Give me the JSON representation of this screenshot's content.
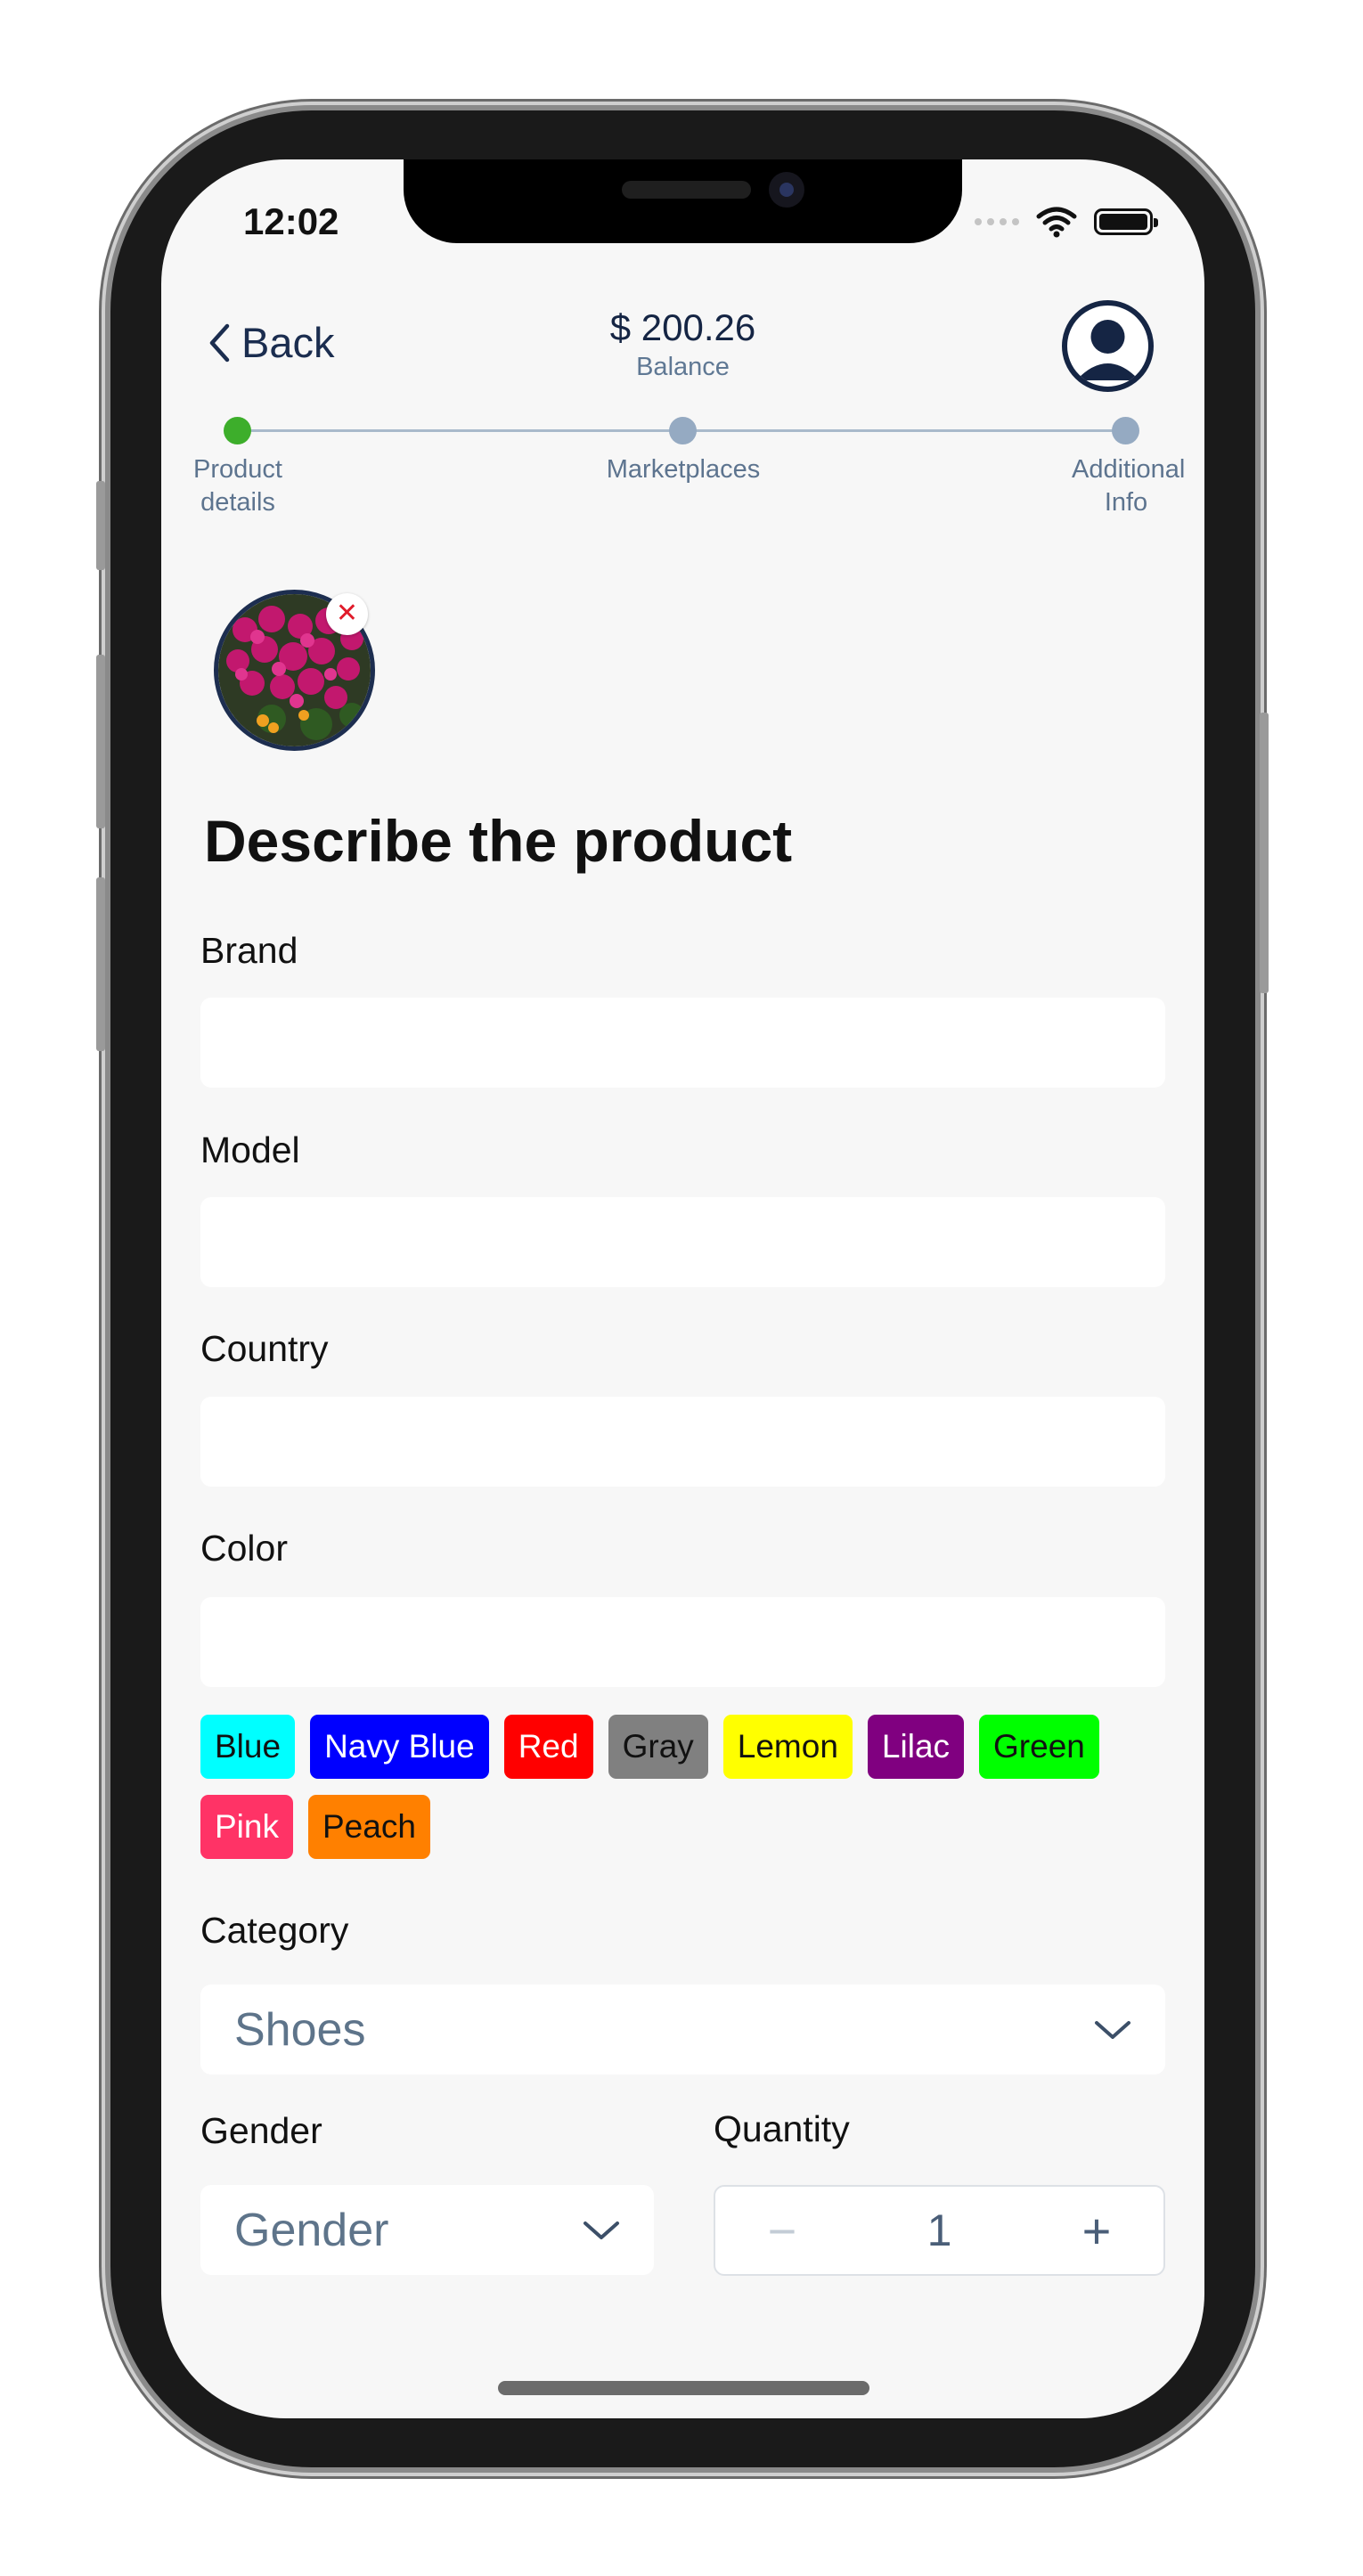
{
  "status_bar": {
    "time": "12:02"
  },
  "header": {
    "back_label": "Back",
    "balance_amount": "$ 200.26",
    "balance_label": "Balance"
  },
  "stepper": {
    "steps": [
      {
        "label": "Product details",
        "state": "done"
      },
      {
        "label": "Marketplaces",
        "state": "pending"
      },
      {
        "label": "Additional Info",
        "state": "pending"
      }
    ],
    "active_color": "#3dae2b",
    "pending_color": "#95aac2"
  },
  "photo": {
    "remove_symbol": "✕"
  },
  "form": {
    "title": "Describe the product",
    "brand": {
      "label": "Brand",
      "value": ""
    },
    "model": {
      "label": "Model",
      "value": ""
    },
    "country": {
      "label": "Country",
      "value": ""
    },
    "color": {
      "label": "Color",
      "value": "",
      "chips": [
        {
          "label": "Blue",
          "bg": "#00ffff",
          "fg": "#111111"
        },
        {
          "label": "Navy Blue",
          "bg": "#0000ff",
          "fg": "#ffffff"
        },
        {
          "label": "Red",
          "bg": "#ff0000",
          "fg": "#ffffff"
        },
        {
          "label": "Gray",
          "bg": "#808080",
          "fg": "#111111"
        },
        {
          "label": "Lemon",
          "bg": "#ffff00",
          "fg": "#111111"
        },
        {
          "label": "Lilac",
          "bg": "#800080",
          "fg": "#ffffff"
        },
        {
          "label": "Green",
          "bg": "#00ff00",
          "fg": "#111111"
        },
        {
          "label": "Pink",
          "bg": "#ff3366",
          "fg": "#ffffff"
        },
        {
          "label": "Peach",
          "bg": "#ff8000",
          "fg": "#111111"
        }
      ]
    },
    "category": {
      "label": "Category",
      "value": "Shoes"
    },
    "gender": {
      "label": "Gender",
      "value": "Gender"
    },
    "quantity": {
      "label": "Quantity",
      "value": "1",
      "minus": "−",
      "plus": "+"
    }
  }
}
